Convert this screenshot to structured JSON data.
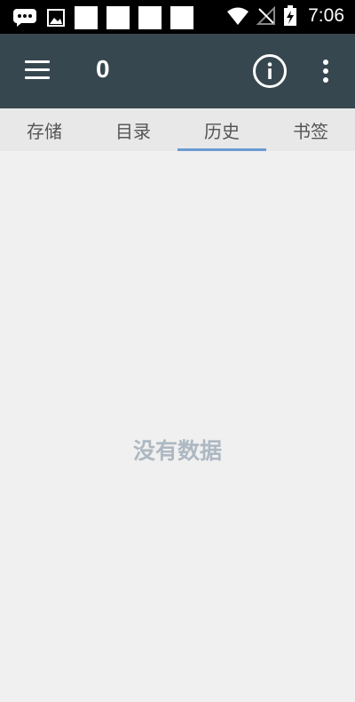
{
  "status_bar": {
    "time": "7:06",
    "icons": [
      "message-icon",
      "image-icon",
      "wifi-icon",
      "no-signal-icon",
      "battery-charging-icon"
    ]
  },
  "toolbar": {
    "title": "0",
    "icons": [
      "menu-icon",
      "info-icon",
      "more-vert-icon"
    ],
    "background": "#37474f"
  },
  "tabs": [
    {
      "label": "存储",
      "active": false
    },
    {
      "label": "目录",
      "active": false
    },
    {
      "label": "历史",
      "active": true
    },
    {
      "label": "书签",
      "active": false
    }
  ],
  "content": {
    "empty_message": "没有数据"
  },
  "colors": {
    "accent": "#6b9bd1",
    "tab_bar": "#e8e8e8",
    "background": "#f0f0f0"
  }
}
